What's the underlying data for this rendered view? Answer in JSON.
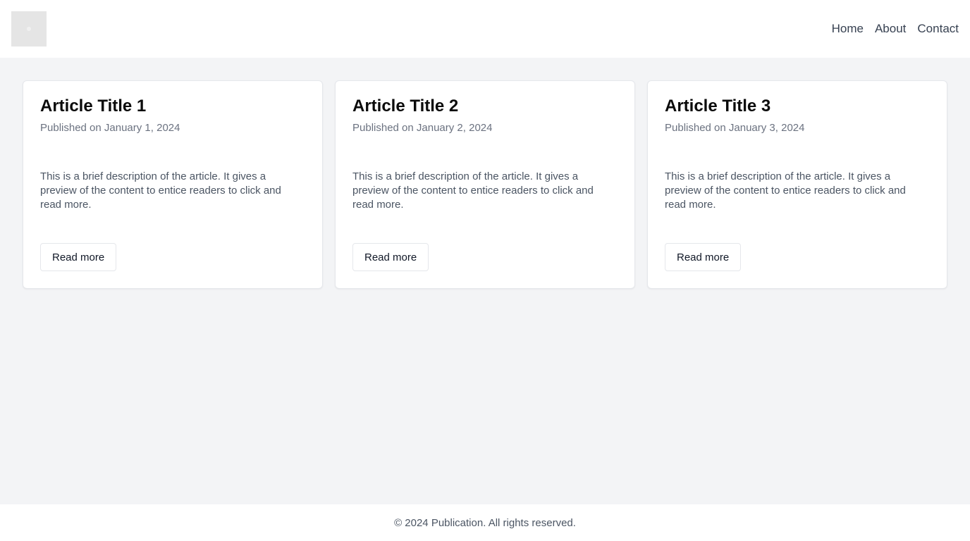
{
  "header": {
    "logo_icon": "placeholder-image-icon",
    "nav": {
      "home": "Home",
      "about": "About",
      "contact": "Contact"
    }
  },
  "articles": [
    {
      "title": "Article Title 1",
      "date": "Published on January 1, 2024",
      "description": "This is a brief description of the article. It gives a preview of the content to entice readers to click and read more.",
      "button": "Read more"
    },
    {
      "title": "Article Title 2",
      "date": "Published on January 2, 2024",
      "description": "This is a brief description of the article. It gives a preview of the content to entice readers to click and read more.",
      "button": "Read more"
    },
    {
      "title": "Article Title 3",
      "date": "Published on January 3, 2024",
      "description": "This is a brief description of the article. It gives a preview of the content to entice readers to click and read more.",
      "button": "Read more"
    }
  ],
  "footer": {
    "text": "© 2024 Publication. All rights reserved."
  },
  "colors": {
    "page_background": "#f3f4f6",
    "surface": "#ffffff",
    "muted_text": "#6b7280",
    "border": "#e5e7eb"
  }
}
